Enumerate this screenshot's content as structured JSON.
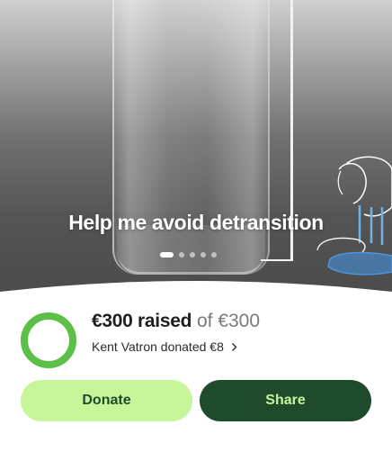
{
  "hero": {
    "title": "Help me avoid detransition",
    "carousel_dots": 5,
    "active_dot": 0
  },
  "progress": {
    "raised_amount": "€300 raised",
    "goal_text": "of €300",
    "fraction": 1.0,
    "ring_color": "#5bbf48",
    "ring_track_color": "#c7f59a"
  },
  "recent_donation": {
    "text": "Kent Vatron donated €8"
  },
  "actions": {
    "donate_label": "Donate",
    "share_label": "Share"
  },
  "colors": {
    "donate_bg": "#c7f59a",
    "share_bg": "#1f4b2c"
  }
}
